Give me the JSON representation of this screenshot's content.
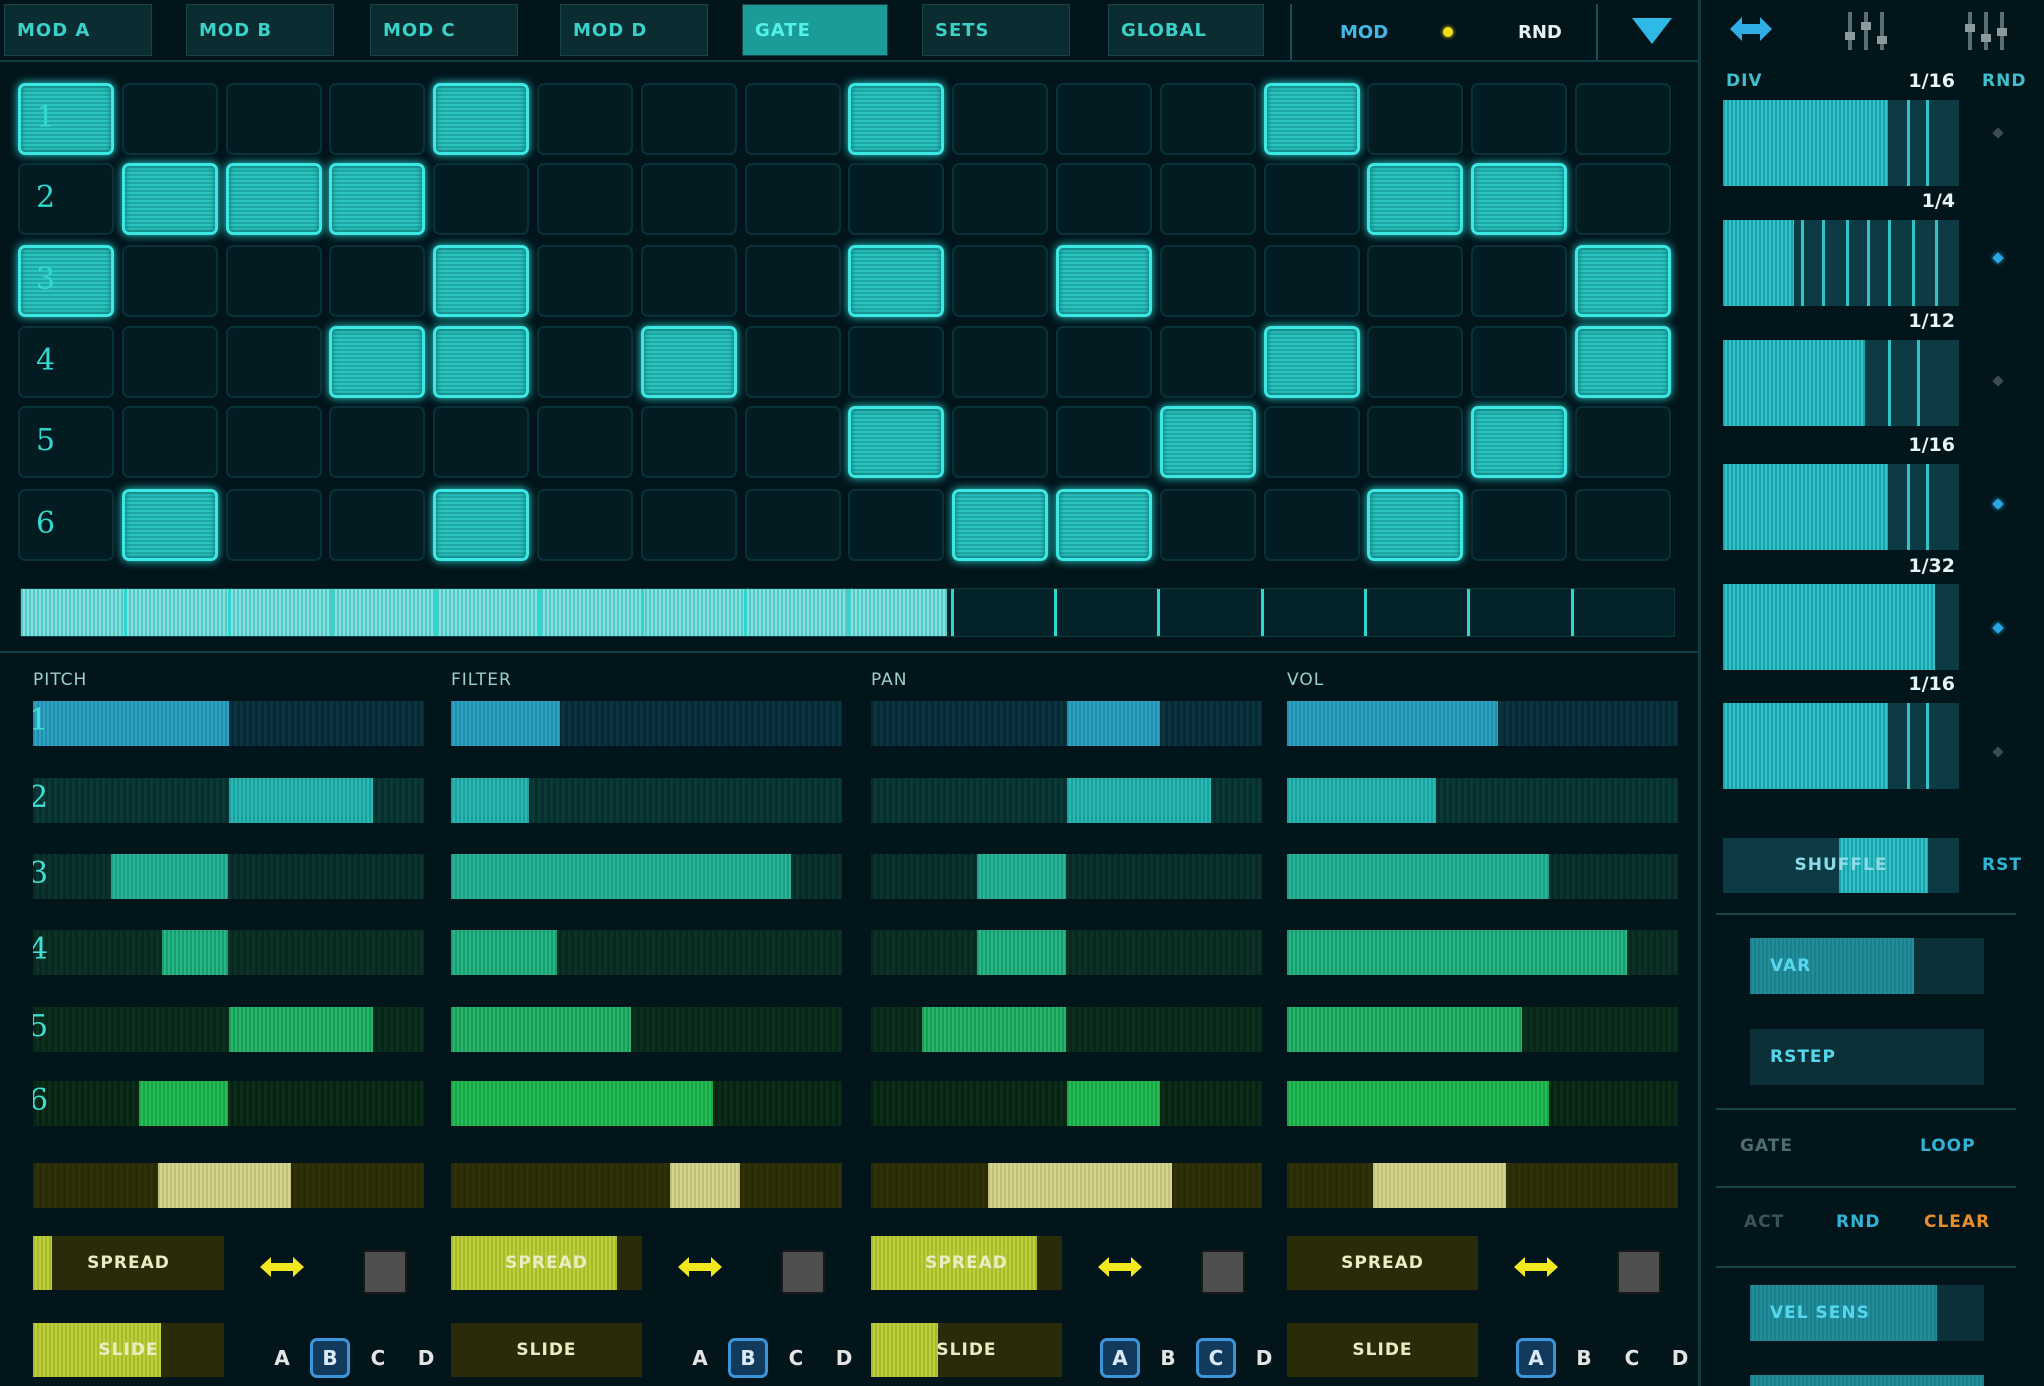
{
  "tabs": [
    {
      "label": "MOD A",
      "active": false
    },
    {
      "label": "MOD B",
      "active": false
    },
    {
      "label": "MOD C",
      "active": false
    },
    {
      "label": "MOD D",
      "active": false
    },
    {
      "label": "GATE",
      "active": true
    },
    {
      "label": "SETS",
      "active": false
    },
    {
      "label": "GLOBAL",
      "active": false
    }
  ],
  "header": {
    "mod_label": "MOD",
    "rnd_label": "RND",
    "icons": [
      "dropdown-triangle-icon",
      "swap-arrows-icon",
      "sliders-icon",
      "sliders-alt-icon"
    ]
  },
  "gate": {
    "row_labels": [
      "1",
      "2",
      "3",
      "4",
      "5",
      "6"
    ],
    "rows": [
      [
        1,
        0,
        0,
        0,
        1,
        0,
        0,
        0,
        1,
        0,
        0,
        0,
        1,
        0,
        0,
        0
      ],
      [
        0,
        1,
        1,
        1,
        0,
        0,
        0,
        0,
        0,
        0,
        0,
        0,
        0,
        1,
        1,
        0
      ],
      [
        1,
        0,
        0,
        0,
        1,
        0,
        0,
        0,
        1,
        0,
        1,
        0,
        0,
        0,
        0,
        1
      ],
      [
        0,
        0,
        0,
        1,
        1,
        0,
        1,
        0,
        0,
        0,
        0,
        0,
        1,
        0,
        0,
        1
      ],
      [
        0,
        0,
        0,
        0,
        0,
        0,
        0,
        0,
        1,
        0,
        0,
        1,
        0,
        0,
        1,
        0
      ],
      [
        0,
        1,
        0,
        0,
        1,
        0,
        0,
        0,
        0,
        1,
        1,
        0,
        0,
        1,
        0,
        0
      ]
    ],
    "progress": 0.56
  },
  "lanes": [
    {
      "title": "PITCH",
      "rows": [
        [
          0,
          0.5
        ],
        [
          0.5,
          0.87
        ],
        [
          0.2,
          0.5
        ],
        [
          0.33,
          0.5
        ],
        [
          0.5,
          0.87
        ],
        [
          0.27,
          0.5
        ]
      ],
      "extra": [
        0.32,
        0.66
      ],
      "spread_label": "SPREAD",
      "spread": 0.1,
      "slide_label": "SLIDE",
      "slide": 0.67,
      "abcd": [
        {
          "l": "A",
          "sel": false
        },
        {
          "l": "B",
          "sel": true
        },
        {
          "l": "C",
          "sel": false
        },
        {
          "l": "D",
          "sel": false
        }
      ]
    },
    {
      "title": "FILTER",
      "rows": [
        [
          0,
          0.28
        ],
        [
          0,
          0.2
        ],
        [
          0,
          0.87
        ],
        [
          0,
          0.27
        ],
        [
          0,
          0.46
        ],
        [
          0,
          0.67
        ]
      ],
      "extra": [
        0.56,
        0.74
      ],
      "spread_label": "SPREAD",
      "spread": 0.87,
      "slide_label": "SLIDE",
      "slide": 0.0,
      "abcd": [
        {
          "l": "A",
          "sel": false
        },
        {
          "l": "B",
          "sel": true
        },
        {
          "l": "C",
          "sel": false
        },
        {
          "l": "D",
          "sel": false
        }
      ]
    },
    {
      "title": "PAN",
      "rows": [
        [
          0.5,
          0.74
        ],
        [
          0.5,
          0.87
        ],
        [
          0.27,
          0.5
        ],
        [
          0.27,
          0.5
        ],
        [
          0.13,
          0.5
        ],
        [
          0.5,
          0.74
        ]
      ],
      "extra": [
        0.3,
        0.77
      ],
      "spread_label": "SPREAD",
      "spread": 0.87,
      "slide_label": "SLIDE",
      "slide": 0.35,
      "abcd": [
        {
          "l": "A",
          "sel": true
        },
        {
          "l": "B",
          "sel": false
        },
        {
          "l": "C",
          "sel": true
        },
        {
          "l": "D",
          "sel": false
        }
      ]
    },
    {
      "title": "VOL",
      "rows": [
        [
          0,
          0.54
        ],
        [
          0,
          0.38
        ],
        [
          0,
          0.67
        ],
        [
          0,
          0.87
        ],
        [
          0,
          0.6
        ],
        [
          0,
          0.67
        ]
      ],
      "extra": [
        0.22,
        0.56
      ],
      "spread_label": "SPREAD",
      "spread": 0.0,
      "slide_label": "SLIDE",
      "slide": 0.0,
      "abcd": [
        {
          "l": "A",
          "sel": true
        },
        {
          "l": "B",
          "sel": false
        },
        {
          "l": "C",
          "sel": false
        },
        {
          "l": "D",
          "sel": false
        }
      ]
    }
  ],
  "right": {
    "div_label": "DIV",
    "rnd_label": "RND",
    "divs": [
      {
        "value": "1/16",
        "fill": 0.7,
        "lines": [
          0.78,
          0.86
        ],
        "dot_on": false
      },
      {
        "value": "1/4",
        "fill": 0.3,
        "lines": [
          0.33,
          0.42,
          0.52,
          0.61,
          0.7,
          0.8,
          0.9
        ],
        "dot_on": true
      },
      {
        "value": "1/12",
        "fill": 0.6,
        "lines": [
          0.7,
          0.82
        ],
        "dot_on": false
      },
      {
        "value": "1/16",
        "fill": 0.7,
        "lines": [
          0.78,
          0.86
        ],
        "dot_on": true
      },
      {
        "value": "1/32",
        "fill": 0.9,
        "lines": [],
        "dot_on": true
      },
      {
        "value": "1/16",
        "fill": 0.7,
        "lines": [
          0.78,
          0.86
        ],
        "dot_on": false
      }
    ],
    "shuffle_label": "SHUFFLE",
    "shuffle_range": [
      0.49,
      0.87
    ],
    "rst_label": "RST",
    "var_label": "VAR",
    "var": 0.7,
    "rstep_label": "RSTEP",
    "rstep": 0.0,
    "gate_label": "GATE",
    "loop_label": "LOOP",
    "act_label": "ACT",
    "rnd2_label": "RND",
    "clear_label": "CLEAR",
    "vel_label": "VEL SENS",
    "vel": 0.8
  },
  "colors": {
    "accent": "#3de8e4",
    "row_colors": [
      "#1f8eb0",
      "#1aa1a0",
      "#1a9e86",
      "#179f72",
      "#189e5a",
      "#16a646"
    ],
    "yellow": "#f2e81e",
    "orange": "#e98d2b"
  }
}
